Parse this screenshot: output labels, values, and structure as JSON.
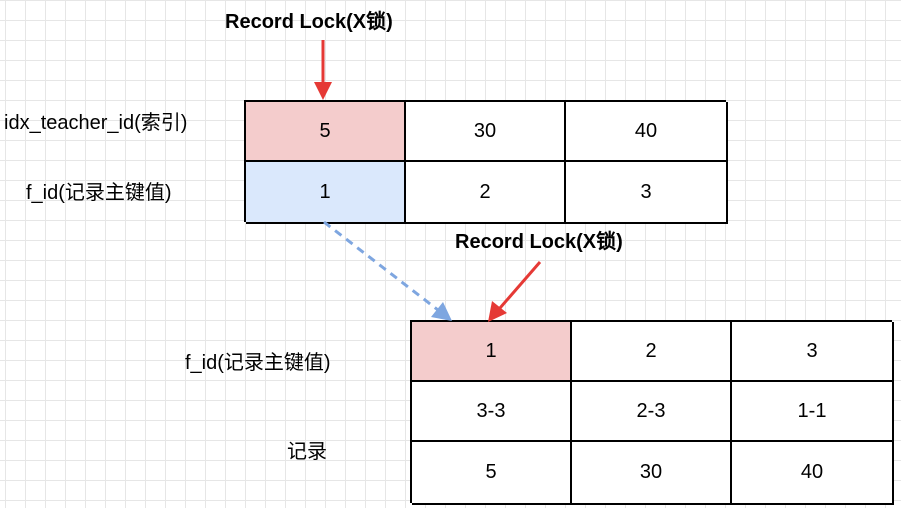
{
  "top": {
    "title": "Record Lock(X锁)",
    "row_labels": [
      "idx_teacher_id(索引)",
      "f_id(记录主键值)"
    ],
    "index_row": [
      "5",
      "30",
      "40"
    ],
    "id_row": [
      "1",
      "2",
      "3"
    ]
  },
  "bottom": {
    "title": "Record Lock(X锁)",
    "id_label": "f_id(记录主键值)",
    "record_label": "记录",
    "rows": [
      [
        "1",
        "2",
        "3"
      ],
      [
        "3-3",
        "2-3",
        "1-1"
      ],
      [
        "5",
        "30",
        "40"
      ]
    ]
  },
  "colors": {
    "locked_fill": "#f4cccc",
    "primary_fill": "#dae8fc",
    "arrow_red": "#e53935",
    "arrow_blue": "#7ea6e0"
  }
}
